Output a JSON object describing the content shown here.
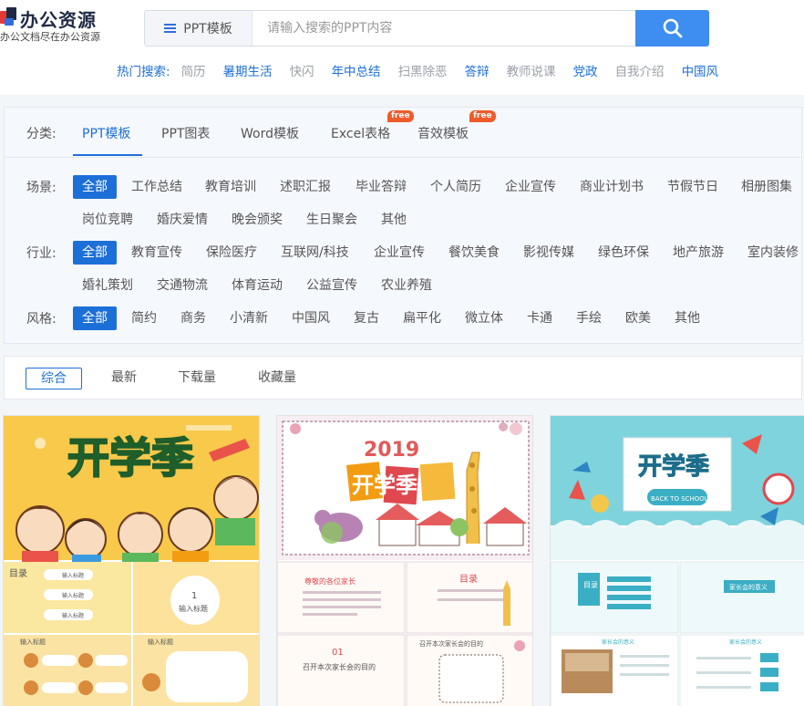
{
  "brand": {
    "name": "办公资源",
    "slogan": "办公文档尽在办公资源"
  },
  "search": {
    "type_label": "PPT模板",
    "placeholder": "请输入搜索的PPT内容",
    "icon": "search-icon"
  },
  "hot_search": {
    "label": "热门搜索:",
    "items": [
      {
        "label": "简历",
        "highlight": false
      },
      {
        "label": "暑期生活",
        "highlight": true
      },
      {
        "label": "快闪",
        "highlight": false
      },
      {
        "label": "年中总结",
        "highlight": true
      },
      {
        "label": "扫黑除恶",
        "highlight": false
      },
      {
        "label": "答辩",
        "highlight": true
      },
      {
        "label": "教师说课",
        "highlight": false
      },
      {
        "label": "党政",
        "highlight": true
      },
      {
        "label": "自我介绍",
        "highlight": false
      },
      {
        "label": "中国风",
        "highlight": true
      }
    ]
  },
  "categories": {
    "label": "分类:",
    "tabs": [
      {
        "label": "PPT模板",
        "active": true,
        "badge": ""
      },
      {
        "label": "PPT图表",
        "active": false,
        "badge": ""
      },
      {
        "label": "Word模板",
        "active": false,
        "badge": ""
      },
      {
        "label": "Excel表格",
        "active": false,
        "badge": "free"
      },
      {
        "label": "音效模板",
        "active": false,
        "badge": "free"
      }
    ]
  },
  "filters": {
    "scene": {
      "label": "场景:",
      "items": [
        "全部",
        "工作总结",
        "教育培训",
        "述职汇报",
        "毕业答辩",
        "个人简历",
        "企业宣传",
        "商业计划书",
        "节假节日",
        "相册图集",
        "岗位竞聘",
        "婚庆爱情",
        "晚会颁奖",
        "生日聚会",
        "其他"
      ]
    },
    "industry": {
      "label": "行业:",
      "items": [
        "全部",
        "教育宣传",
        "保险医疗",
        "互联网/科技",
        "企业宣传",
        "餐饮美食",
        "影视传媒",
        "绿色环保",
        "地产旅游",
        "室内装修",
        "婚礼策划",
        "交通物流",
        "体育运动",
        "公益宣传",
        "农业养殖"
      ]
    },
    "style": {
      "label": "风格:",
      "items": [
        "全部",
        "简约",
        "商务",
        "小清新",
        "中国风",
        "复古",
        "扁平化",
        "微立体",
        "卡通",
        "手绘",
        "欧美",
        "其他"
      ]
    }
  },
  "sort": {
    "items": [
      "综合",
      "最新",
      "下载量",
      "收藏量"
    ],
    "active": "综合"
  },
  "cards": [
    {
      "title": "开学季",
      "slides": {
        "toc": "目录",
        "toc_items": [
          "输入标题",
          "输入标题",
          "输入标题"
        ],
        "number": "1",
        "number_caption": "输入标题",
        "section": "输入标题"
      }
    },
    {
      "title": "开学季",
      "year": "2019",
      "slides": {
        "greeting": "尊敬的各位家长",
        "toc": "目录",
        "number": "01",
        "meeting": "召开本次家长会的目的"
      }
    },
    {
      "title": "开学季",
      "subtitle": "BACK TO SCHOOL",
      "slides": {
        "toc": "目录",
        "meaning": "家长会的意义"
      }
    }
  ],
  "colors": {
    "brand_blue": "#1d6fd8",
    "search_blue": "#3d8ef0",
    "badge_orange": "#ef5b2b",
    "card1_yellow": "#f7c23c",
    "card3_cyan": "#7fd3dc"
  }
}
